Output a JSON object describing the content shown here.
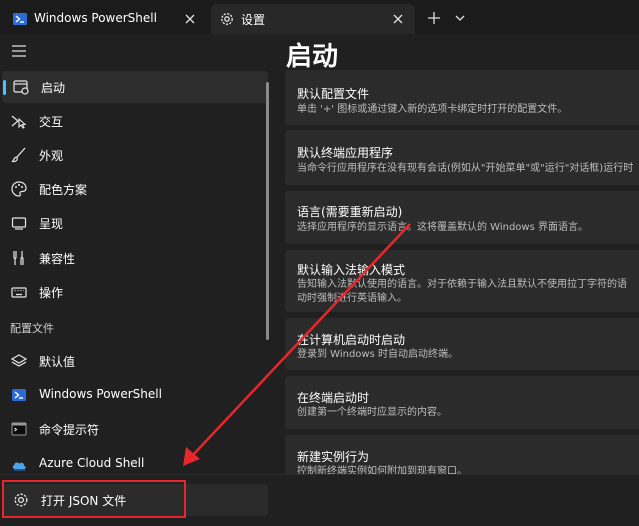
{
  "tabs": [
    {
      "title": "Windows PowerShell",
      "icon": "powershell-icon"
    },
    {
      "title": "设置",
      "icon": "gear-icon"
    }
  ],
  "sidebar": {
    "items": [
      {
        "label": "启动",
        "icon": "startup-icon"
      },
      {
        "label": "交互",
        "icon": "interaction-icon"
      },
      {
        "label": "外观",
        "icon": "brush-icon"
      },
      {
        "label": "配色方案",
        "icon": "palette-icon"
      },
      {
        "label": "呈现",
        "icon": "monitor-icon"
      },
      {
        "label": "兼容性",
        "icon": "compatibility-icon"
      },
      {
        "label": "操作",
        "icon": "keyboard-icon"
      }
    ],
    "profiles_header": "配置文件",
    "profiles": [
      {
        "label": "默认值",
        "icon": "layers-icon"
      },
      {
        "label": "Windows PowerShell",
        "icon": "powershell-icon"
      },
      {
        "label": "命令提示符",
        "icon": "cmd-icon"
      },
      {
        "label": "Azure Cloud Shell",
        "icon": "cloud-icon"
      }
    ],
    "open_json": {
      "label": "打开 JSON 文件",
      "icon": "gear-icon"
    }
  },
  "main": {
    "title": "启动",
    "cards": [
      {
        "title": "默认配置文件",
        "desc": "单击 '+' 图标或通过键入新的选项卡绑定时打开的配置文件。"
      },
      {
        "title": "默认终端应用程序",
        "desc": "当命令行应用程序在没有现有会话(例如从\"开始菜单\"或\"运行\"对话框)运行时"
      },
      {
        "title": "语言(需要重新启动)",
        "desc": "选择应用程序的显示语言。这将覆盖默认的 Windows 界面语言。"
      },
      {
        "title": "默认输入法输入模式",
        "desc": "告知输入法默认使用的语言。对于依赖于输入法且默认不使用拉丁字符的语",
        "desc2": "动时强制进行英语输入。"
      },
      {
        "title": "在计算机启动时启动",
        "desc": "登录到 Windows 时自动启动终端。"
      },
      {
        "title": "在终端启动时",
        "desc": "创建第一个终端时应显示的内容。"
      },
      {
        "title": "新建实例行为",
        "desc": "控制新终端实例如何附加到现有窗口。"
      }
    ]
  },
  "colors": {
    "accent": "#4cc2ff",
    "annotation_red": "#e8262b"
  }
}
